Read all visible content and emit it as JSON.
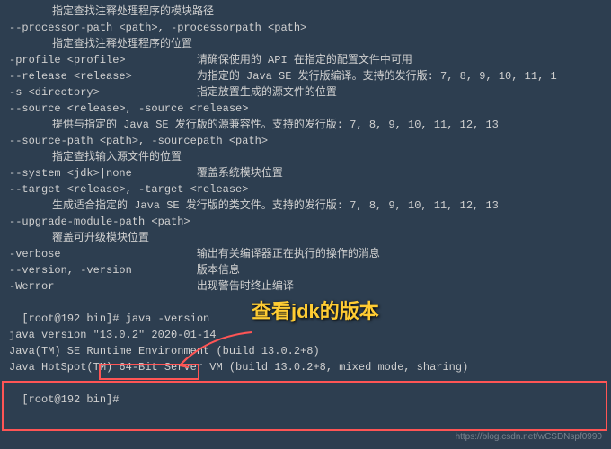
{
  "lines": {
    "l0": "指定查找注释处理程序的模块路径",
    "l1": "--processor-path <path>, -processorpath <path>",
    "l2": "指定查找注释处理程序的位置",
    "l3": "-profile <profile>           请确保使用的 API 在指定的配置文件中可用",
    "l4": "--release <release>          为指定的 Java SE 发行版编译。支持的发行版: 7, 8, 9, 10, 11, 1",
    "l5": "-s <directory>               指定放置生成的源文件的位置",
    "l6": "--source <release>, -source <release>",
    "l7": "提供与指定的 Java SE 发行版的源兼容性。支持的发行版: 7, 8, 9, 10, 11, 12, 13",
    "l8": "--source-path <path>, -sourcepath <path>",
    "l9": "指定查找输入源文件的位置",
    "l10": "--system <jdk>|none          覆盖系统模块位置",
    "l11": "--target <release>, -target <release>",
    "l12": "生成适合指定的 Java SE 发行版的类文件。支持的发行版: 7, 8, 9, 10, 11, 12, 13",
    "l13": "--upgrade-module-path <path>",
    "l14": "覆盖可升级模块位置",
    "l15": "-verbose                     输出有关编译器正在执行的操作的消息",
    "l16": "--version, -version          版本信息",
    "l17": "-Werror                      出现警告时终止编译",
    "l18": "",
    "prompt1a": "[root@192 bin]# ",
    "prompt1b": "java -version",
    "l20": "java version \"13.0.2\" 2020-01-14",
    "l21": "Java(TM) SE Runtime Environment (build 13.0.2+8)",
    "l22": "Java HotSpot(TM) 64-Bit Server VM (build 13.0.2+8, mixed mode, sharing)",
    "prompt2": "[root@192 bin]# "
  },
  "annotation": "查看jdk的版本",
  "watermark": "https://blog.csdn.net/wCSDNspf0990"
}
